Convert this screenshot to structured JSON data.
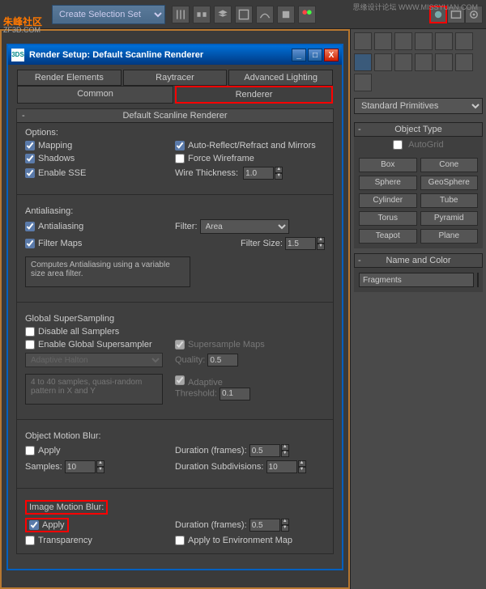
{
  "watermarks": {
    "tl1": "朱峰社区",
    "tl2": "ZF3D.COM",
    "tr": "思缘设计论坛 WWW.MISSYUAN.COM"
  },
  "topbar": {
    "dropdown": "Create Selection Set"
  },
  "rightPanel": {
    "category": "Standard Primitives",
    "objectType": {
      "title": "Object Type",
      "autogrid": "AutoGrid",
      "buttons": [
        "Box",
        "Cone",
        "Sphere",
        "GeoSphere",
        "Cylinder",
        "Tube",
        "Torus",
        "Pyramid",
        "Teapot",
        "Plane"
      ]
    },
    "nameColor": {
      "title": "Name and Color",
      "name": "Fragments"
    }
  },
  "dialog": {
    "title": "Render Setup: Default Scanline Renderer",
    "iconText": "3DS",
    "tabs": {
      "row1": [
        "Render Elements",
        "Raytracer",
        "Advanced Lighting"
      ],
      "row2": [
        "Common",
        "Renderer"
      ]
    },
    "rolloutTitle": "Default Scanline Renderer",
    "options": {
      "header": "Options:",
      "mapping": "Mapping",
      "autoReflect": "Auto-Reflect/Refract and Mirrors",
      "shadows": "Shadows",
      "forceWire": "Force Wireframe",
      "enableSSE": "Enable SSE",
      "wireThick": "Wire Thickness:",
      "wireThickVal": "1.0"
    },
    "antialiasing": {
      "header": "Antialiasing:",
      "antialiasing": "Antialiasing",
      "filterLabel": "Filter:",
      "filterVal": "Area",
      "filterMaps": "Filter Maps",
      "filterSizeLabel": "Filter Size:",
      "filterSizeVal": "1.5",
      "desc": "Computes Antialiasing using a variable size area filter."
    },
    "gss": {
      "header": "Global SuperSampling",
      "disableAll": "Disable all Samplers",
      "enableGlobal": "Enable Global Supersampler",
      "supersampleMaps": "Supersample Maps",
      "method": "Adaptive Halton",
      "qualityLabel": "Quality:",
      "qualityVal": "0.5",
      "adaptive": "Adaptive",
      "thresholdLabel": "Threshold:",
      "thresholdVal": "0.1",
      "desc": "4 to 40 samples, quasi-random pattern in X and Y"
    },
    "omb": {
      "header": "Object Motion Blur:",
      "apply": "Apply",
      "durationLabel": "Duration (frames):",
      "durationVal": "0.5",
      "samplesLabel": "Samples:",
      "samplesVal": "10",
      "subdivLabel": "Duration Subdivisions:",
      "subdivVal": "10"
    },
    "imb": {
      "header": "Image Motion Blur:",
      "apply": "Apply",
      "durationLabel": "Duration (frames):",
      "durationVal": "0.5",
      "transparency": "Transparency",
      "applyEnv": "Apply to Environment Map"
    }
  }
}
